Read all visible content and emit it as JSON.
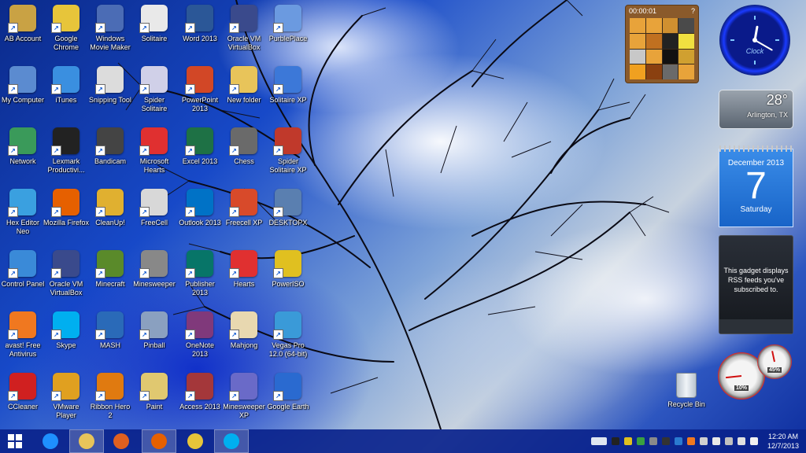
{
  "desktop": {
    "icons": [
      {
        "label": "AB Account",
        "icon": "user-folder-icon",
        "color": "#c9a244"
      },
      {
        "label": "Google Chrome",
        "icon": "chrome-icon",
        "color": "#e7c53a"
      },
      {
        "label": "Windows Movie Maker",
        "icon": "film-icon",
        "color": "#4b6cb5"
      },
      {
        "label": "Solitaire",
        "icon": "playing-card-icon",
        "color": "#e9e9e9"
      },
      {
        "label": "Word 2013",
        "icon": "word-icon",
        "color": "#2b5797"
      },
      {
        "label": "Oracle VM VirtualBox",
        "icon": "virtualbox-icon",
        "color": "#3a4a8c"
      },
      {
        "label": "PurblePlace",
        "icon": "purble-place-icon",
        "color": "#6b9ae0"
      },
      {
        "label": "My Computer",
        "icon": "computer-icon",
        "color": "#5b8bd0"
      },
      {
        "label": "iTunes",
        "icon": "itunes-icon",
        "color": "#3a8fe0"
      },
      {
        "label": "Snipping Tool",
        "icon": "scissors-icon",
        "color": "#dcdcdc"
      },
      {
        "label": "Spider Solitaire",
        "icon": "spider-card-icon",
        "color": "#d0d0e8"
      },
      {
        "label": "PowerPoint 2013",
        "icon": "powerpoint-icon",
        "color": "#d24726"
      },
      {
        "label": "New folder",
        "icon": "folder-icon",
        "color": "#e8c45a"
      },
      {
        "label": "Solitaire XP",
        "icon": "cards-xp-icon",
        "color": "#3c78d8"
      },
      {
        "label": "Network",
        "icon": "network-globe-icon",
        "color": "#3a9a5a"
      },
      {
        "label": "Lexmark Productivi...",
        "icon": "lexmark-icon",
        "color": "#222222"
      },
      {
        "label": "Bandicam",
        "icon": "bandicam-icon",
        "color": "#444444"
      },
      {
        "label": "Microsoft Hearts",
        "icon": "heart-icon",
        "color": "#e03030"
      },
      {
        "label": "Excel 2013",
        "icon": "excel-icon",
        "color": "#1e7145"
      },
      {
        "label": "Chess",
        "icon": "chess-knight-icon",
        "color": "#6a6a6a"
      },
      {
        "label": "Spider Solitaire XP",
        "icon": "spider-icon",
        "color": "#c0392b"
      },
      {
        "label": "Hex Editor Neo",
        "icon": "hex-cubes-icon",
        "color": "#3aa0e0"
      },
      {
        "label": "Mozilla Firefox",
        "icon": "firefox-icon",
        "color": "#e66000"
      },
      {
        "label": "CleanUp!",
        "icon": "cleanup-hand-icon",
        "color": "#e0b030"
      },
      {
        "label": "FreeCell",
        "icon": "freecell-king-icon",
        "color": "#d8d8d8"
      },
      {
        "label": "Outlook 2013",
        "icon": "outlook-icon",
        "color": "#0072c6"
      },
      {
        "label": "Freecell XP",
        "icon": "freecell-xp-icon",
        "color": "#d84a2a"
      },
      {
        "label": "DESKTOPX",
        "icon": "desktopx-icon",
        "color": "#5a7fb0"
      },
      {
        "label": "Control Panel",
        "icon": "control-panel-icon",
        "color": "#3a8ad8"
      },
      {
        "label": "Oracle VM VirtualBox",
        "icon": "virtualbox-icon",
        "color": "#3a4a8c"
      },
      {
        "label": "Minecraft",
        "icon": "minecraft-block-icon",
        "color": "#5a8a2a"
      },
      {
        "label": "Minesweeper",
        "icon": "mine-icon",
        "color": "#888888"
      },
      {
        "label": "Publisher 2013",
        "icon": "publisher-icon",
        "color": "#077568"
      },
      {
        "label": "Hearts",
        "icon": "hearts-card-icon",
        "color": "#e03030"
      },
      {
        "label": "PowerISO",
        "icon": "disc-icon",
        "color": "#e0c020"
      },
      {
        "label": "avast! Free Antivirus",
        "icon": "avast-icon",
        "color": "#f07820"
      },
      {
        "label": "Skype",
        "icon": "skype-icon",
        "color": "#00aff0"
      },
      {
        "label": "MASH",
        "icon": "mash-icon",
        "color": "#2a6ab8"
      },
      {
        "label": "Pinball",
        "icon": "pinball-icon",
        "color": "#8aa0c0"
      },
      {
        "label": "OneNote 2013",
        "icon": "onenote-icon",
        "color": "#80397b"
      },
      {
        "label": "Mahjong",
        "icon": "mahjong-tile-icon",
        "color": "#e8d8b0"
      },
      {
        "label": "Vegas Pro 12.0 (64-bit)",
        "icon": "vegas-play-icon",
        "color": "#3a9ad8"
      },
      {
        "label": "CCleaner",
        "icon": "ccleaner-icon",
        "color": "#d02020"
      },
      {
        "label": "VMware Player",
        "icon": "vmware-icon",
        "color": "#e0a020"
      },
      {
        "label": "Ribbon Hero 2",
        "icon": "ribbon-hero-icon",
        "color": "#e07a10"
      },
      {
        "label": "Paint",
        "icon": "paint-palette-icon",
        "color": "#e0c870"
      },
      {
        "label": "Access 2013",
        "icon": "access-icon",
        "color": "#a4373a"
      },
      {
        "label": "Minesweeper XP",
        "icon": "mine-xp-icon",
        "color": "#6a6ac8"
      },
      {
        "label": "Google Earth",
        "icon": "google-earth-icon",
        "color": "#2a6ad0"
      }
    ],
    "recycle_bin": "Recycle Bin"
  },
  "gadgets": {
    "puzzle": {
      "timer": "00:00:01",
      "help": "?"
    },
    "clock": {
      "brand": "Clock",
      "hour": 12,
      "minute": 20
    },
    "weather": {
      "temp": "28°",
      "location": "Arlington, TX"
    },
    "calendar": {
      "month": "December 2013",
      "day": "7",
      "weekday": "Saturday"
    },
    "rss": {
      "message": "This gadget displays RSS feeds you've subscribed to."
    },
    "cpu_meter": {
      "cpu": "10%",
      "memory": "45%",
      "cpu_fraction": 0.1,
      "memory_fraction": 0.45
    }
  },
  "taskbar": {
    "apps": [
      {
        "name": "internet-explorer-icon",
        "color": "#1e90ff",
        "active": false
      },
      {
        "name": "file-explorer-icon",
        "color": "#e8c45a",
        "active": true
      },
      {
        "name": "media-player-icon",
        "color": "#e06020",
        "active": false
      },
      {
        "name": "firefox-icon",
        "color": "#e66000",
        "active": true
      },
      {
        "name": "chrome-icon",
        "color": "#e7c53a",
        "active": false
      },
      {
        "name": "skype-icon",
        "color": "#00aff0",
        "active": true
      }
    ],
    "time": "12:20 AM",
    "date": "12/7/2013"
  },
  "colors": {
    "taskbar": "#0a238c",
    "accent": "#1864c8"
  }
}
